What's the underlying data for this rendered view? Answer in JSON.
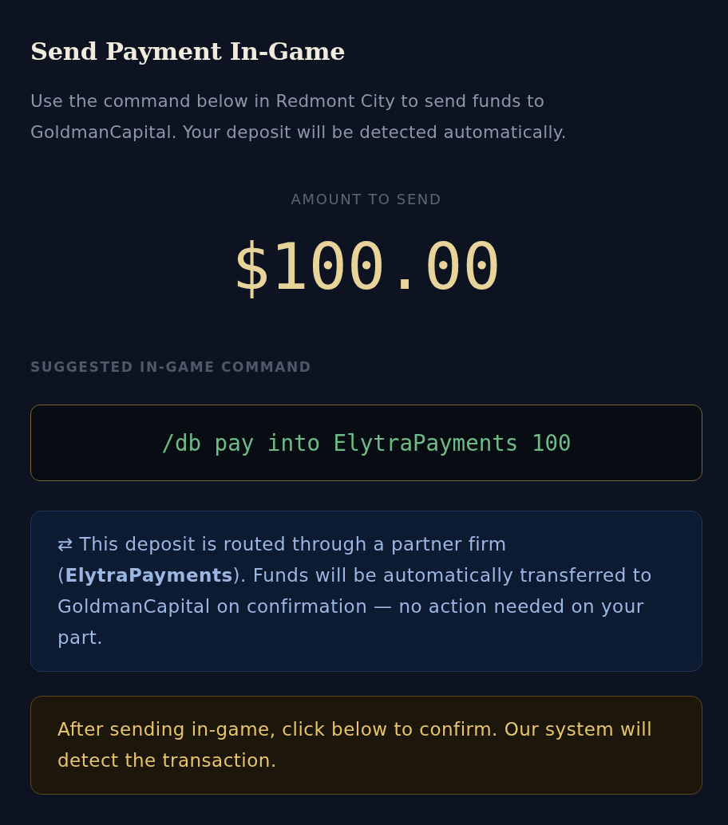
{
  "title": "Send Payment In-Game",
  "subtitle": "Use the command below in Redmont City to send funds to GoldmanCapital. Your deposit will be detected automatically.",
  "amount": {
    "label": "AMOUNT TO SEND",
    "value": "$100.00"
  },
  "command": {
    "label": "SUGGESTED IN-GAME COMMAND",
    "text": "/db pay into ElytraPayments 100"
  },
  "notices": [
    {
      "kind": "info",
      "text": "⇄ This deposit is routed through a partner firm (**ElytraPayments**). Funds will be automatically transferred to GoldmanCapital on confirmation — no action needed on your part."
    },
    {
      "kind": "warning",
      "text": "After sending in-game, click below to confirm. Our system will detect the transaction."
    }
  ]
}
